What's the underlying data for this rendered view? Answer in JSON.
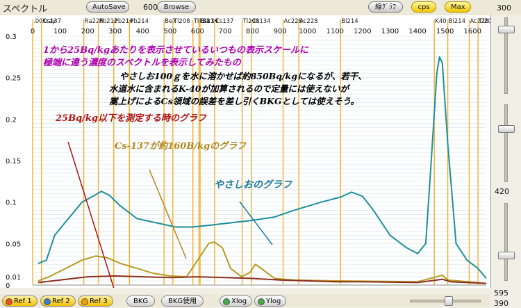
{
  "title": "スペクトル",
  "toolbar": {
    "autosave_label": "AutoSave",
    "save_count": "600",
    "browse_label": "Browse",
    "line_graph_label": "線ｸﾞﾗﾌ",
    "cps_label": "cps",
    "max_label": "Max"
  },
  "right_panel": {
    "top_value": "300",
    "mid_value": "420",
    "low_value": "595",
    "bottom_value": "390"
  },
  "bottom_bar": {
    "ref1": "Ref 1",
    "ref2": "Ref 2",
    "ref3": "Ref 3",
    "bkg": "BKG",
    "bkg_use": "BKG使用",
    "xlog": "Xlog",
    "ylog": "Ylog",
    "colors": {
      "ref1": "#e8501e",
      "ref2": "#2f7fd8",
      "ref3": "#f0a000",
      "xlog": "#44aa44",
      "ylog": "#44aa44"
    }
  },
  "chart_data": {
    "type": "line",
    "xlim": [
      0,
      1650
    ],
    "ylim": [
      0,
      0.3
    ],
    "x_ticks": [
      0,
      100,
      200,
      300,
      400,
      500,
      600,
      700,
      800,
      900,
      1000,
      1100,
      1200,
      1300,
      1400,
      1500,
      1600
    ],
    "y_tick_labels": [
      "0.3",
      "0.25",
      "0.2",
      "0.15",
      "0.1",
      "0.05",
      "0.01",
      "0"
    ],
    "y_tick_values": [
      0.3,
      0.25,
      0.2,
      0.15,
      0.1,
      0.05,
      0.01,
      0
    ],
    "grid": true,
    "nuclide_lines": [
      {
        "label": ".00Cs137",
        "x": 0
      },
      {
        "label": "Xray",
        "x": 32
      },
      {
        "label": "Ra226",
        "x": 186
      },
      {
        "label": "Pb212",
        "x": 239
      },
      {
        "label": "Pb214",
        "x": 295
      },
      {
        "label": "Pb214",
        "x": 352
      },
      {
        "label": "Be7",
        "x": 478
      },
      {
        "label": "Tl208",
        "x": 510
      },
      {
        "label": "Tl208",
        "x": 583
      },
      {
        "label": "Bi214",
        "x": 609
      },
      {
        "label": "Cs134",
        "x": 605
      },
      {
        "label": "Cs137",
        "x": 662
      },
      {
        "label": "Tl208",
        "x": 762
      },
      {
        "label": "Cs134",
        "x": 796
      },
      {
        "label": "Ac228",
        "x": 911
      },
      {
        "label": "Ac228",
        "x": 968
      },
      {
        "label": "Bi214",
        "x": 1120
      },
      {
        "label": "K40",
        "x": 1461
      },
      {
        "label": "Bi214",
        "x": 1510
      },
      {
        "label": "Ac228",
        "x": 1588
      },
      {
        "label": "Tl208",
        "x": 1620
      }
    ],
    "series": [
      {
        "color": "#1e8e9a",
        "points": [
          [
            20,
            0.026
          ],
          [
            50,
            0.03
          ],
          [
            80,
            0.06
          ],
          [
            130,
            0.08
          ],
          [
            180,
            0.1
          ],
          [
            225,
            0.108
          ],
          [
            250,
            0.113
          ],
          [
            280,
            0.108
          ],
          [
            320,
            0.095
          ],
          [
            380,
            0.08
          ],
          [
            450,
            0.075
          ],
          [
            520,
            0.07
          ],
          [
            580,
            0.07
          ],
          [
            640,
            0.072
          ],
          [
            720,
            0.075
          ],
          [
            800,
            0.078
          ],
          [
            880,
            0.082
          ],
          [
            950,
            0.09
          ],
          [
            1050,
            0.1
          ],
          [
            1120,
            0.106
          ],
          [
            1160,
            0.112
          ],
          [
            1200,
            0.107
          ],
          [
            1240,
            0.09
          ],
          [
            1300,
            0.06
          ],
          [
            1360,
            0.045
          ],
          [
            1400,
            0.038
          ],
          [
            1430,
            0.05
          ],
          [
            1450,
            0.15
          ],
          [
            1470,
            0.255
          ],
          [
            1480,
            0.275
          ],
          [
            1490,
            0.268
          ],
          [
            1510,
            0.17
          ],
          [
            1540,
            0.05
          ],
          [
            1580,
            0.03
          ],
          [
            1620,
            0.02
          ],
          [
            1650,
            0.008
          ]
        ]
      },
      {
        "color": "#b89a20",
        "points": [
          [
            20,
            0.005
          ],
          [
            60,
            0.01
          ],
          [
            120,
            0.02
          ],
          [
            180,
            0.03
          ],
          [
            230,
            0.035
          ],
          [
            270,
            0.033
          ],
          [
            320,
            0.026
          ],
          [
            380,
            0.02
          ],
          [
            440,
            0.014
          ],
          [
            500,
            0.011
          ],
          [
            560,
            0.01
          ],
          [
            600,
            0.03
          ],
          [
            640,
            0.05
          ],
          [
            660,
            0.052
          ],
          [
            690,
            0.045
          ],
          [
            720,
            0.02
          ],
          [
            760,
            0.01
          ],
          [
            790,
            0.015
          ],
          [
            810,
            0.025
          ],
          [
            840,
            0.018
          ],
          [
            880,
            0.008
          ],
          [
            950,
            0.006
          ],
          [
            1100,
            0.005
          ],
          [
            1400,
            0.004
          ],
          [
            1470,
            0.01
          ],
          [
            1490,
            0.012
          ],
          [
            1510,
            0.006
          ],
          [
            1650,
            0.002
          ]
        ]
      },
      {
        "color": "#8a3020",
        "points": [
          [
            20,
            0.003
          ],
          [
            100,
            0.006
          ],
          [
            200,
            0.01
          ],
          [
            300,
            0.011
          ],
          [
            400,
            0.01
          ],
          [
            500,
            0.009
          ],
          [
            600,
            0.01
          ],
          [
            700,
            0.009
          ],
          [
            800,
            0.008
          ],
          [
            900,
            0.006
          ],
          [
            1000,
            0.005
          ],
          [
            1100,
            0.004
          ],
          [
            1200,
            0.004
          ],
          [
            1400,
            0.003
          ],
          [
            1470,
            0.006
          ],
          [
            1490,
            0.007
          ],
          [
            1520,
            0.004
          ],
          [
            1650,
            0.002
          ]
        ]
      }
    ],
    "annotations": [
      {
        "text": "1から25Bq/kgあたりを表示させているいつもの表示スケールに",
        "color": "#b000b0"
      },
      {
        "text": "極端に違う濃度のスペクトルを表示してみたもの",
        "color": "#b000b0"
      },
      {
        "text": "やさしお100ｇを水に溶かせば約850Bq/kgになるが、若干、",
        "color": "#000000"
      },
      {
        "text": "水道水に含まれるK-40が加算されるので定量には使えないが",
        "color": "#000000"
      },
      {
        "text": "嵩上げによるCs領域の誤差を差し引くBKGとしては使えそう。",
        "color": "#000000"
      },
      {
        "text": "25Bq/kg以下を測定する時のグラフ",
        "color": "#b01010"
      },
      {
        "text": "Cs-137が約160B/kgのグラフ",
        "color": "#b08820"
      },
      {
        "text": "やさしおのグラフ",
        "color": "#1a7aa0"
      }
    ]
  }
}
